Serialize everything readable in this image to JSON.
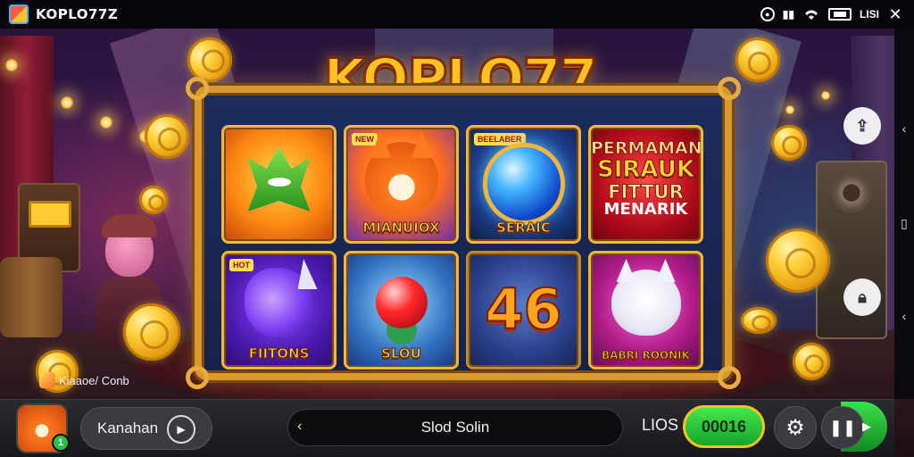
{
  "statusbar": {
    "app_title": "KOPLO77Z",
    "icons": [
      "record-icon",
      "signal-icon",
      "wifi-icon",
      "battery-icon",
      "lte-icon",
      "close-icon"
    ],
    "lte_label": "LISI"
  },
  "logo": {
    "text": "KOPLO77"
  },
  "tiles": [
    {
      "name": "green-wolf",
      "caption": "",
      "tag": ""
    },
    {
      "name": "fox",
      "caption": "MIANUIOX",
      "tag": "NEW"
    },
    {
      "name": "orb",
      "caption": "SERAIC",
      "tag": "BEELABER"
    },
    {
      "name": "promo",
      "lines": [
        "PERMAMAN",
        "SIRAUK",
        "FITTUR",
        "MENARIK"
      ]
    },
    {
      "name": "dragon",
      "caption": "FIITONS",
      "tag": "HOT"
    },
    {
      "name": "gem",
      "caption": "SLOU",
      "tag": ""
    },
    {
      "name": "number",
      "caption": "46"
    },
    {
      "name": "cat",
      "caption": "BABRI ROONIK",
      "tag": ""
    }
  ],
  "caption_left": "Kiaaoe/ Conb",
  "bottom": {
    "user_label": "Kanahan",
    "search_label": "Slod Solin",
    "lios_label": "LIOS",
    "balance": "00016",
    "avatar_badge": "1"
  },
  "colors": {
    "accent_gold": "#f0b640",
    "balance_green": "#2fcf3e",
    "frame_blue": "#16224a"
  }
}
